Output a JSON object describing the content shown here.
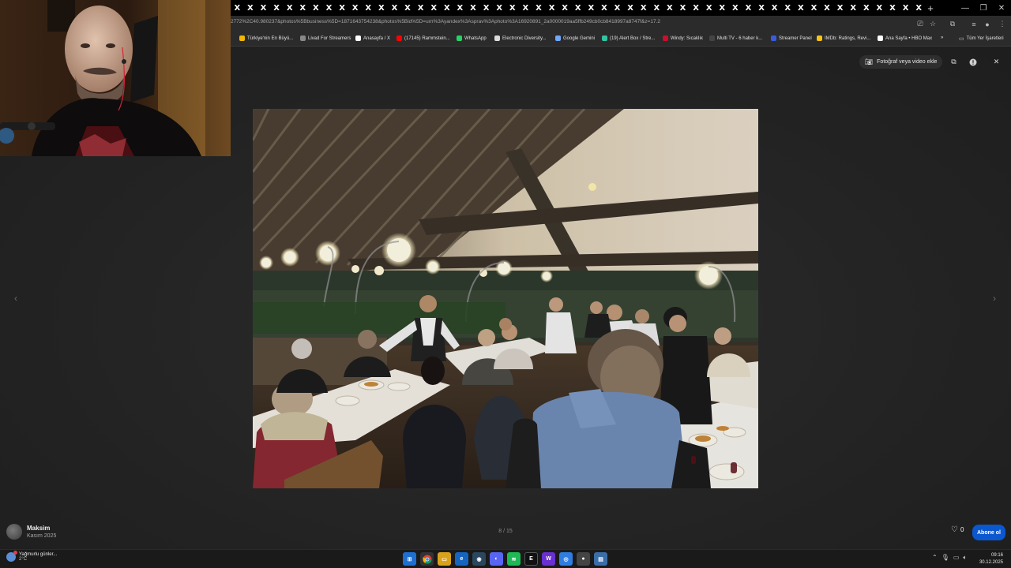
{
  "browser": {
    "tab_glyph": "X",
    "url": "2772%2C40.980237&photos%5Bbusiness%5D=1871643754238&photos%5Bid%5D=urn%3Ayandex%3Asprav%3Aphoto%3A16920891_2a0000019aa5ffb249cb0cb8418997a8747f&z=17.2",
    "bookmarks": [
      {
        "label": "Türkiye'nin En Büyü...",
        "color": "#f2b705"
      },
      {
        "label": "Livad For Streamers",
        "color": "#888888"
      },
      {
        "label": "Anasayfa / X",
        "color": "#ffffff"
      },
      {
        "label": "(17145) Rammstein...",
        "color": "#ff0000"
      },
      {
        "label": "WhatsApp",
        "color": "#25d366"
      },
      {
        "label": "Electronic Diversity...",
        "color": "#dddddd"
      },
      {
        "label": "Google Gemini",
        "color": "#6ea8ff"
      },
      {
        "label": "(19) Alert Box / Stre...",
        "color": "#31c3a2"
      },
      {
        "label": "Windy: Sıcaklık",
        "color": "#c8102e"
      },
      {
        "label": "Multi TV - 6 haber k...",
        "color": "#444444"
      },
      {
        "label": "Streamer Panel",
        "color": "#3b5bdb"
      },
      {
        "label": "IMDb: Ratings, Revi...",
        "color": "#f5c518"
      },
      {
        "label": "Ana Sayfa • HBO Max",
        "color": "#ffffff"
      }
    ],
    "bookmarks_overflow": "»",
    "all_bookmarks": "Tüm Yer İşaretleri"
  },
  "viewer": {
    "add_media_label": "Fotoğraf veya video ekle",
    "counter": "8 / 15",
    "author_name": "Maksim",
    "author_date": "Kasım 2025",
    "like_count": "0",
    "subscribe_label": "Abone ol"
  },
  "taskbar": {
    "weather_text": "Yağmurlu günler...",
    "temperature": "2°C",
    "time": "09:16",
    "date": "30.12.2025"
  },
  "colors": {
    "subscribe_bg": "#0b57d0",
    "viewer_bg": "#262626"
  }
}
